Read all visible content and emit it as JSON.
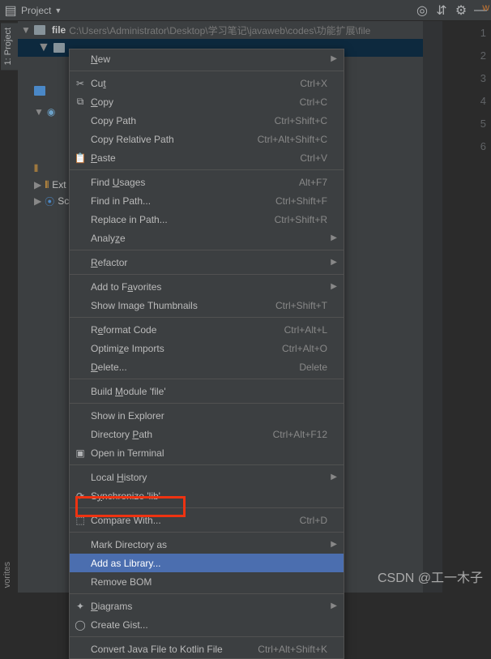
{
  "toolbar": {
    "project": "Project",
    "right_w": "w"
  },
  "sidebar": {
    "project_tab": "1: Project",
    "favorites": "vorites"
  },
  "path": {
    "folder": "file",
    "rest": "C:\\Users\\Administrator\\Desktop\\学习笔记\\javaweb\\codes\\功能扩展\\file"
  },
  "tree": {
    "ext": "Ext",
    "scr": "Scr"
  },
  "gutter": {
    "1": "1",
    "2": "2",
    "3": "3",
    "4": "4",
    "5": "5",
    "6": "6"
  },
  "menu": {
    "new": "New",
    "cut": "Cut",
    "cut_s": "Ctrl+X",
    "copy": "Copy",
    "copy_s": "Ctrl+C",
    "copypath": "Copy Path",
    "copypath_s": "Ctrl+Shift+C",
    "copyrel": "Copy Relative Path",
    "copyrel_s": "Ctrl+Alt+Shift+C",
    "paste": "Paste",
    "paste_s": "Ctrl+V",
    "findusages": "Find Usages",
    "findusages_s": "Alt+F7",
    "findinpath": "Find in Path...",
    "findinpath_s": "Ctrl+Shift+F",
    "replinpath": "Replace in Path...",
    "replinpath_s": "Ctrl+Shift+R",
    "analyze": "Analyze",
    "refactor": "Refactor",
    "addfav": "Add to Favorites",
    "showthumb": "Show Image Thumbnails",
    "showthumb_s": "Ctrl+Shift+T",
    "reformat": "Reformat Code",
    "reformat_s": "Ctrl+Alt+L",
    "optimize": "Optimize Imports",
    "optimize_s": "Ctrl+Alt+O",
    "delete": "Delete...",
    "delete_s": "Delete",
    "buildmod": "Build Module 'file'",
    "showexp": "Show in Explorer",
    "dirpath": "Directory Path",
    "dirpath_s": "Ctrl+Alt+F12",
    "openterm": "Open in Terminal",
    "localhist": "Local History",
    "sync": "Synchronize 'lib'",
    "compare": "Compare With...",
    "compare_s": "Ctrl+D",
    "markdir": "Mark Directory as",
    "addlib": "Add as Library...",
    "rembom": "Remove BOM",
    "diagrams": "Diagrams",
    "gist": "Create Gist...",
    "convkotlin": "Convert Java File to Kotlin File",
    "convkotlin_s": "Ctrl+Alt+Shift+K"
  },
  "watermark": "CSDN @工一木子"
}
